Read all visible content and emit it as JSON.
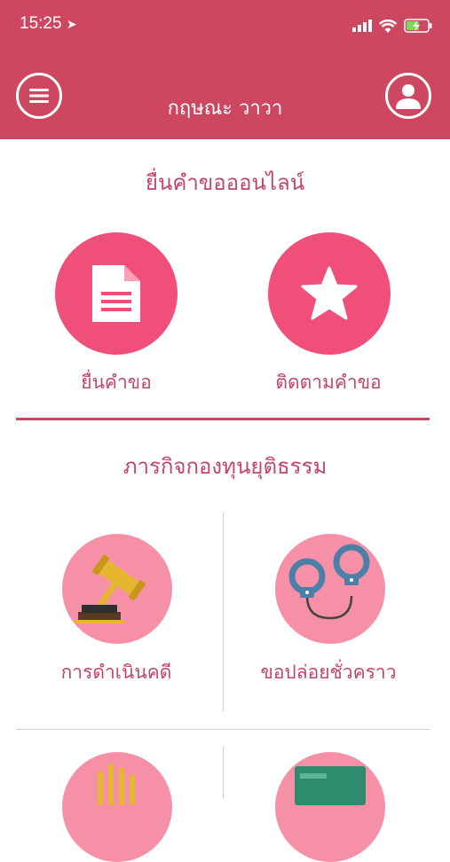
{
  "status_bar": {
    "time": "15:25"
  },
  "header": {
    "title": "กฤษณะ วาวา"
  },
  "section_online": {
    "title": "ยื่นคำขอออนไลน์",
    "items": [
      {
        "label": "ยื่นคำขอ",
        "icon": "document-icon"
      },
      {
        "label": "ติดตามคำขอ",
        "icon": "star-icon"
      }
    ]
  },
  "section_fund": {
    "title": "ภารกิจกองทุนยุติธรรม",
    "items": [
      {
        "label": "การดำเนินคดี",
        "icon": "gavel-icon"
      },
      {
        "label": "ขอปล่อยชั่วคราว",
        "icon": "handcuffs-icon"
      }
    ]
  },
  "colors": {
    "header": "#cd4761",
    "accent": "#ef4f78",
    "light_pink": "#f690a7",
    "text_accent": "#c2456a"
  }
}
